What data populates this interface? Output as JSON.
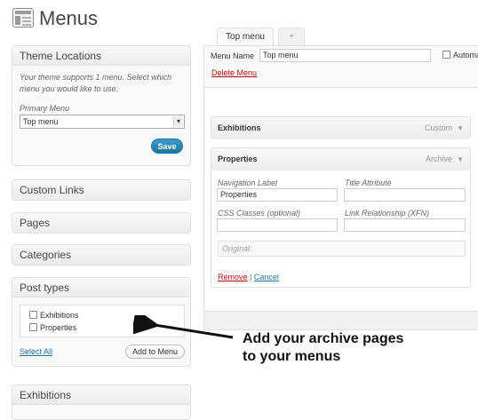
{
  "header": {
    "title": "Menus"
  },
  "theme_locations": {
    "title": "Theme Locations",
    "description": "Your theme supports 1 menu. Select which menu you would like to use.",
    "field_label": "Primary Menu",
    "selected": "Top menu",
    "save_label": "Save"
  },
  "panels": {
    "custom_links": "Custom Links",
    "pages": "Pages",
    "categories": "Categories",
    "exhibitions": "Exhibitions"
  },
  "post_types": {
    "title": "Post types",
    "items": [
      "Exhibitions",
      "Properties"
    ],
    "select_all": "Select All",
    "add_to_menu": "Add to Menu"
  },
  "tabs": {
    "active": "Top menu",
    "add": "+"
  },
  "menu_editor": {
    "name_label": "Menu Name",
    "name_value": "Top menu",
    "auto_add_label": "Automa",
    "delete_label": "Delete Menu"
  },
  "items": {
    "exhibitions": {
      "title": "Exhibitions",
      "type": "Custom"
    },
    "properties": {
      "title": "Properties",
      "type": "Archive",
      "nav_label": "Navigation Label",
      "nav_value": "Properties",
      "title_attr_label": "Title Attribute",
      "css_label": "CSS Classes (optional)",
      "xfn_label": "Link Relationship (XFN)",
      "original_label": "Original:",
      "remove_label": "Remove",
      "separator": "|",
      "cancel_label": "Cancel"
    }
  },
  "annotation": {
    "line1": "Add your archive pages",
    "line2": "to your menus"
  }
}
